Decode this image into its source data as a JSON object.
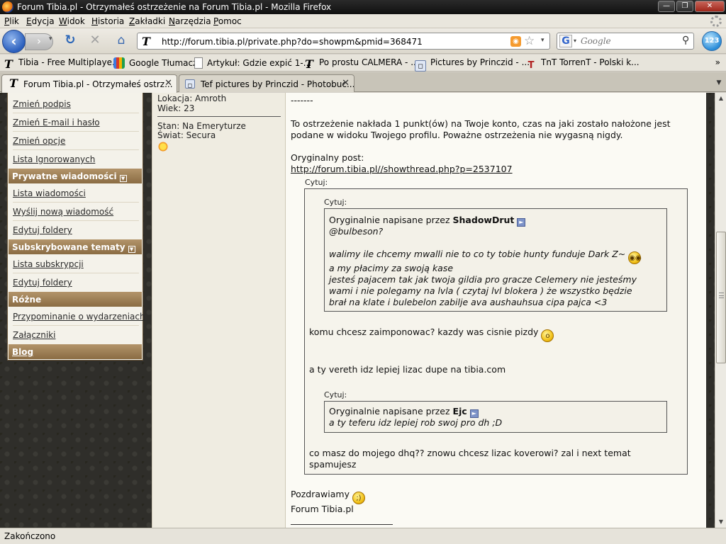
{
  "window": {
    "title": "Forum Tibia.pl - Otrzymałeś ostrzeżenie na Forum Tibia.pl - Mozilla Firefox",
    "min_glyph": "—",
    "max_glyph": "❐",
    "close_glyph": "✕"
  },
  "menu": [
    "Plik",
    "Edycja",
    "Widok",
    "Historia",
    "Zakładki",
    "Narzędzia",
    "Pomoc"
  ],
  "toolbar": {
    "back_glyph": "‹",
    "forward_glyph": "›",
    "reload_glyph": "↻",
    "stop_glyph": "✕",
    "home_glyph": "⌂",
    "url": "http://forum.tibia.pl/private.php?do=showpm&pmid=368471",
    "search_placeholder": "Google",
    "search_engine_letter": "G"
  },
  "bookmarks": [
    "Tibia - Free Multiplaye...",
    "Google Tłumacz",
    "Artykuł: Gdzie expić 1-...",
    "Po prostu CALMERA - ...",
    "Pictures by Princzid - ...",
    "TnT TorrenT - Polski k..."
  ],
  "bookmarks_more": "»",
  "tabs": [
    {
      "label": "Forum Tibia.pl - Otrzymałeś ostrz...",
      "icon": "tibia-icon"
    },
    {
      "label": "Tef pictures by Princzid - Photobuc...",
      "icon": "photobucket-icon"
    }
  ],
  "sidebar": {
    "links_top": [
      "Zmień podpis",
      "Zmień E-mail i hasło",
      "Zmień opcje",
      "Lista Ignorowanych"
    ],
    "section_pm": "Prywatne wiadomości",
    "links_pm": [
      "Lista wiadomości",
      "Wyślij nową wiadomość",
      "Edytuj foldery"
    ],
    "section_subs": "Subskrybowane tematy",
    "links_subs": [
      "Lista subskrypcji",
      "Edytuj foldery"
    ],
    "section_misc": "Różne",
    "links_misc": [
      "Przypominanie o wydarzeniach",
      "Załączniki"
    ],
    "section_blog": "Blog"
  },
  "userinfo": {
    "location": "Lokacja: Amroth",
    "age": "Wiek: 23",
    "status": "Stan: Na Emeryturze",
    "world": "Świat: Secura"
  },
  "message": {
    "dashes": "-------",
    "warning_line1": "To ostrzeżenie nakłada 1 punkt(ów) na Twoje konto, czas na jaki zostało nałożone jest",
    "warning_line2": "podane w widoku Twojego profilu. Poważne ostrzeżenia nie wygasną nigdy.",
    "original_post_label": "Oryginalny post:",
    "original_post_url": "http://forum.tibia.pl//showthread.php?p=2537107",
    "quote_label": "Cytuj:",
    "outer_quote": {
      "inner_label": "Cytuj:",
      "inner_prefix": "Oryginalnie napisane przez",
      "inner_author": "ShadowDrut",
      "inner_lines": [
        "@bulbeson?",
        "walimy ile chcemy mwalli nie to co ty tobie hunty funduje Dark Z~",
        "a my płacimy za swoją kase",
        "jesteś pajacem tak jak twoja gildia pro gracze Celemery nie jesteśmy",
        "wami i nie polegamy na lvla ( czytaj lvl blokera ) że wszystko będzie",
        "brał na klate i bulebelon zabilje ava aushauhsua cipa pajca <3"
      ],
      "reply1": "komu chcesz zaimponowac? kazdy was cisnie pizdy",
      "reply2": "a ty vereth idz lepiej lizac dupe na tibia.com",
      "second_label": "Cytuj:",
      "second_prefix": "Oryginalnie napisane przez",
      "second_author": "Ejc",
      "second_line": "a ty teferu idz lepiej rob swoj pro dh ;D",
      "reply3_line1": "co masz do mojego dhq?? znowu chcesz lizac koverowi? zal i next temat",
      "reply3_line2": "spamujesz"
    },
    "closing": "Pozdrawiamy",
    "signature": "Forum Tibia.pl"
  },
  "status_bar": "Zakończono",
  "colors": {
    "nav_header": "#9c7d52",
    "page_background": "#2f2e2a",
    "message_background": "#fbfaf4"
  }
}
